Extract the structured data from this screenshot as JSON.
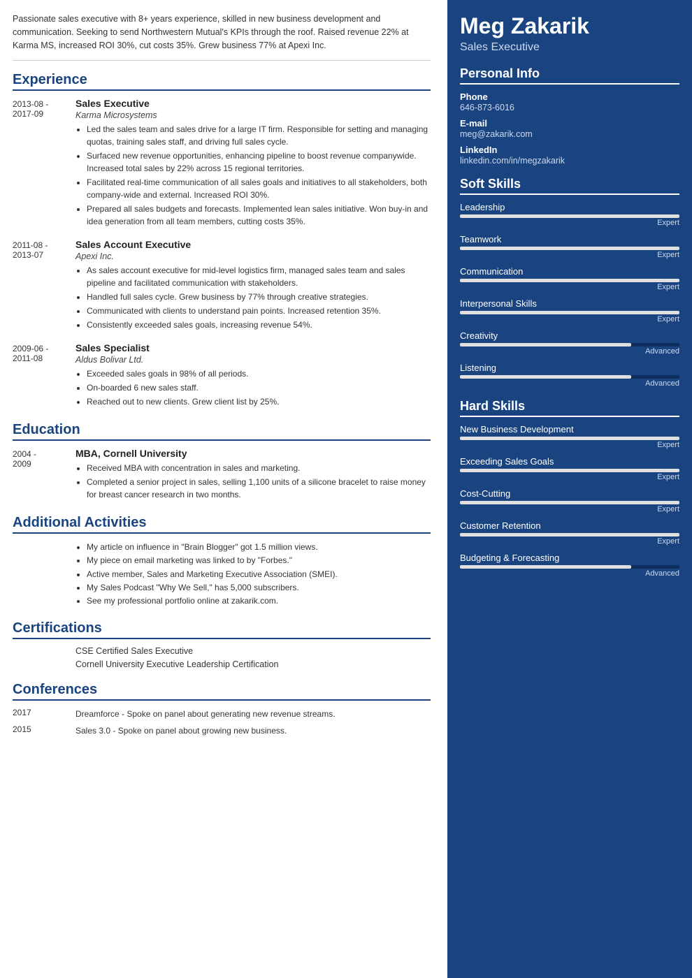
{
  "left": {
    "summary": "Passionate sales executive with 8+ years experience, skilled in new business development and communication. Seeking to send Northwestern Mutual's KPIs through the roof. Raised revenue 22% at Karma MS, increased ROI 30%, cut costs 35%. Grew business 77% at Apexi Inc.",
    "sections": {
      "experience": {
        "label": "Experience",
        "jobs": [
          {
            "start": "2013-08 -",
            "end": "2017-09",
            "title": "Sales Executive",
            "company": "Karma Microsystems",
            "bullets": [
              "Led the sales team and sales drive for a large IT firm. Responsible for setting and managing quotas, training sales staff, and driving full sales cycle.",
              "Surfaced new revenue opportunities, enhancing pipeline to boost revenue companywide. Increased total sales by 22% across 15 regional territories.",
              "Facilitated real-time communication of all sales goals and initiatives to all stakeholders, both company-wide and external. Increased ROI 30%.",
              "Prepared all sales budgets and forecasts. Implemented lean sales initiative. Won buy-in and idea generation from all team members, cutting costs 35%."
            ]
          },
          {
            "start": "2011-08 -",
            "end": "2013-07",
            "title": "Sales Account Executive",
            "company": "Apexi Inc.",
            "bullets": [
              "As sales account executive for mid-level logistics firm, managed sales team and sales pipeline and facilitated communication with stakeholders.",
              "Handled full sales cycle. Grew business by 77% through creative strategies.",
              "Communicated with clients to understand pain points. Increased retention 35%.",
              "Consistently exceeded sales goals, increasing revenue 54%."
            ]
          },
          {
            "start": "2009-06 -",
            "end": "2011-08",
            "title": "Sales Specialist",
            "company": "Aldus Bolivar Ltd.",
            "bullets": [
              "Exceeded sales goals in 98% of all periods.",
              "On-boarded 6 new sales staff.",
              "Reached out to new clients. Grew client list by 25%."
            ]
          }
        ]
      },
      "education": {
        "label": "Education",
        "items": [
          {
            "start": "2004 -",
            "end": "2009",
            "degree": "MBA, Cornell University",
            "bullets": [
              "Received MBA with concentration in sales and marketing.",
              "Completed a senior project in sales, selling 1,100 units of a silicone bracelet to raise money for breast cancer research in two months."
            ]
          }
        ]
      },
      "activities": {
        "label": "Additional Activities",
        "bullets": [
          "My article on influence in \"Brain Blogger\" got 1.5 million views.",
          "My piece on email marketing was linked to by \"Forbes.\"",
          "Active member, Sales and Marketing Executive Association (SMEI).",
          "My Sales Podcast \"Why We Sell,\" has 5,000 subscribers.",
          "See my professional portfolio online at zakarik.com."
        ]
      },
      "certifications": {
        "label": "Certifications",
        "items": [
          "CSE Certified Sales Executive",
          "Cornell University Executive Leadership Certification"
        ]
      },
      "conferences": {
        "label": "Conferences",
        "items": [
          {
            "year": "2017",
            "desc": "Dreamforce - Spoke on panel about generating new revenue streams."
          },
          {
            "year": "2015",
            "desc": "Sales 3.0 - Spoke on panel about growing new business."
          }
        ]
      }
    }
  },
  "right": {
    "name": "Meg Zakarik",
    "role": "Sales Executive",
    "personal_info": {
      "label": "Personal Info",
      "phone_label": "Phone",
      "phone": "646-873-6016",
      "email_label": "E-mail",
      "email": "meg@zakarik.com",
      "linkedin_label": "LinkedIn",
      "linkedin": "linkedin.com/in/megzakarik"
    },
    "soft_skills": {
      "label": "Soft Skills",
      "items": [
        {
          "name": "Leadership",
          "level": "expert",
          "label": "Expert"
        },
        {
          "name": "Teamwork",
          "level": "expert",
          "label": "Expert"
        },
        {
          "name": "Communication",
          "level": "expert",
          "label": "Expert"
        },
        {
          "name": "Interpersonal Skills",
          "level": "expert",
          "label": "Expert"
        },
        {
          "name": "Creativity",
          "level": "advanced",
          "label": "Advanced"
        },
        {
          "name": "Listening",
          "level": "advanced",
          "label": "Advanced"
        }
      ]
    },
    "hard_skills": {
      "label": "Hard Skills",
      "items": [
        {
          "name": "New Business Development",
          "level": "expert",
          "label": "Expert"
        },
        {
          "name": "Exceeding Sales Goals",
          "level": "expert",
          "label": "Expert"
        },
        {
          "name": "Cost-Cutting",
          "level": "expert",
          "label": "Expert"
        },
        {
          "name": "Customer Retention",
          "level": "expert",
          "label": "Expert"
        },
        {
          "name": "Budgeting & Forecasting",
          "level": "advanced",
          "label": "Advanced"
        }
      ]
    }
  }
}
